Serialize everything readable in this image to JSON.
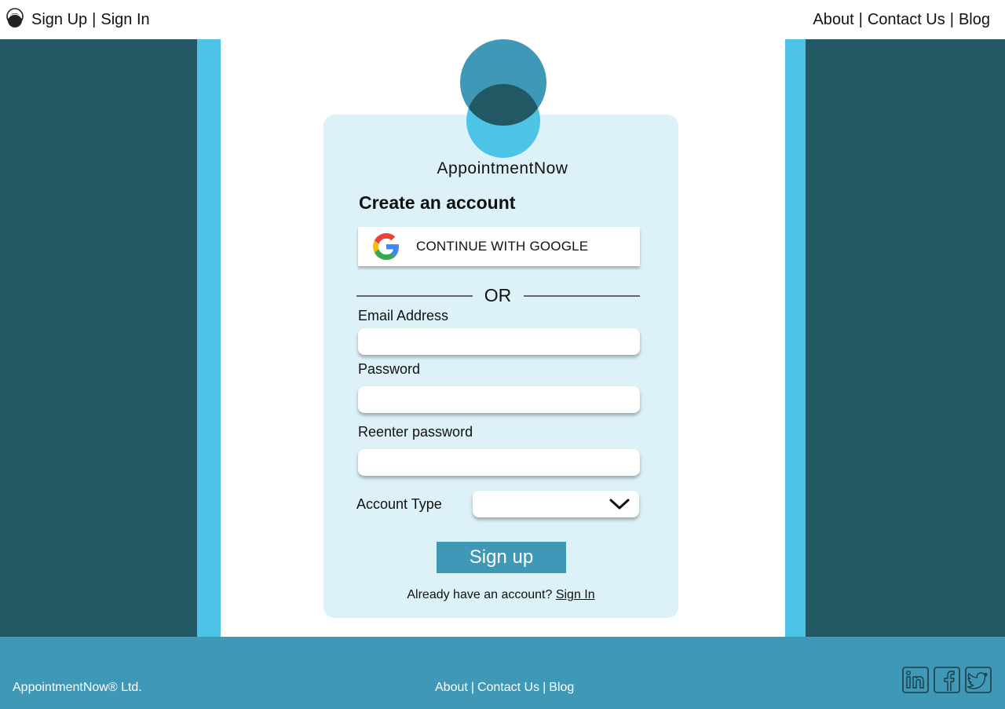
{
  "colors": {
    "dark_teal": "#225764",
    "light_blue": "#4dc3e5",
    "card_bg": "#dcf1f8",
    "accent": "#3f98b5"
  },
  "header": {
    "logo_icon": "appointmentnow-logo-icon",
    "sign_up": "Sign Up",
    "sep": "|",
    "sign_in": "Sign In",
    "nav": {
      "about": "About",
      "contact": "Contact Us",
      "blog": "Blog"
    }
  },
  "card": {
    "brand": "AppointmentNow",
    "heading": "Create an account",
    "google_icon": "google-icon",
    "google_label": "CONTINUE WITH GOOGLE",
    "or": "OR",
    "email_label": "Email Address",
    "email_value": "",
    "password_label": "Password",
    "password_value": "",
    "reenter_label": "Reenter password",
    "reenter_value": "",
    "account_type_label": "Account Type",
    "account_type_value": "",
    "submit": "Sign up",
    "already_text": "Already have an account?",
    "sign_in_link": "Sign In"
  },
  "footer": {
    "copyright": "AppointmentNow® Ltd.",
    "about": "About",
    "contact": "Contact Us",
    "blog": "Blog",
    "sep": "|",
    "social_icons": [
      "linkedin-icon",
      "facebook-icon",
      "twitter-icon"
    ]
  }
}
